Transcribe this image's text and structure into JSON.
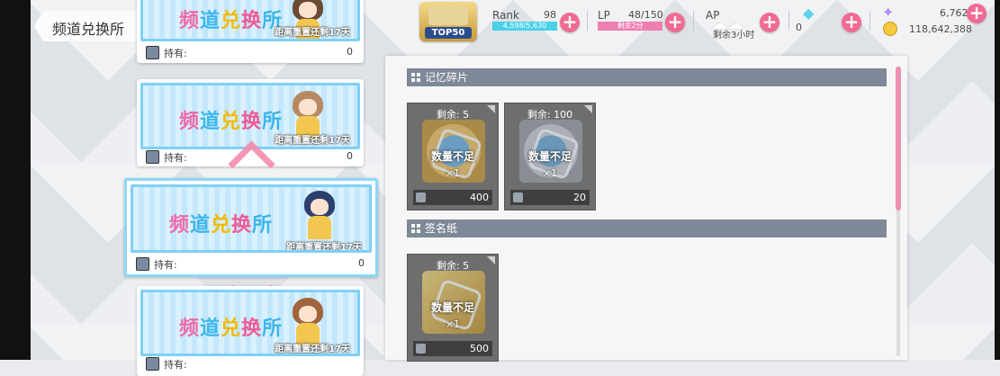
{
  "header": {
    "title": "频道兑换所"
  },
  "status": {
    "event_badge_text": "TOP50",
    "rank_label": "Rank",
    "rank_value": "98",
    "rank_exp": "4,598/5,630",
    "lp_label": "LP",
    "lp_value": "48/150",
    "lp_timer": "剩余2分",
    "ap_label": "AP",
    "ap_timer": "剩余3小时",
    "gems": "0",
    "star_gems": "6,762",
    "gold": "118,642,388",
    "accent_pink": "#f06b93",
    "exp_bar_color": "#49d1e9"
  },
  "cards": [
    {
      "banner": "频道兑换所",
      "reset_text": "距离重置还剩17天",
      "own_label": "持有:",
      "own_count": "0",
      "hair_color": "#6b4a35"
    },
    {
      "banner": "频道兑换所",
      "reset_text": "距离重置还剩17天",
      "own_label": "持有:",
      "own_count": "0",
      "hair_color": "#b78962"
    },
    {
      "banner": "频道兑换所",
      "reset_text": "距离重置还剩17天",
      "own_label": "持有:",
      "own_count": "0",
      "hair_color": "#2c3f6c"
    },
    {
      "banner": "频道兑换所",
      "reset_text": "距离重置还剩17天",
      "own_label": "持有:",
      "own_count": "",
      "hair_color": "#a0653e"
    }
  ],
  "sections": [
    {
      "title": "记忆碎片",
      "items": [
        {
          "remain": "剩余: 5",
          "status": "数量不足",
          "qty": "×1",
          "cost": "400",
          "art": "gold"
        },
        {
          "remain": "剩余: 100",
          "status": "数量不足",
          "qty": "×1",
          "cost": "20",
          "art": "silver"
        }
      ]
    },
    {
      "title": "签名纸",
      "items": [
        {
          "remain": "剩余: 5",
          "status": "数量不足",
          "qty": "×1",
          "cost": "500",
          "art": "paper"
        }
      ]
    }
  ]
}
